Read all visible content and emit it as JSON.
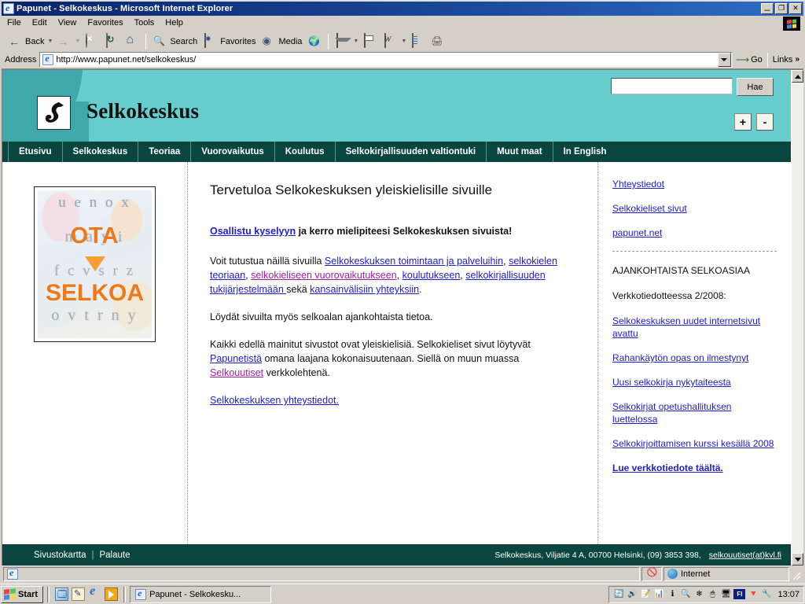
{
  "window": {
    "title": "Papunet - Selkokeskus  - Microsoft Internet Explorer",
    "minimize_label": "_",
    "maximize_label": "❐",
    "close_label": "✕"
  },
  "menubar": {
    "items": [
      "File",
      "Edit",
      "View",
      "Favorites",
      "Tools",
      "Help"
    ]
  },
  "toolbar": {
    "back_label": "Back",
    "search_label": "Search",
    "favorites_label": "Favorites",
    "media_label": "Media"
  },
  "addressbar": {
    "label": "Address",
    "url": "http://www.papunet.net/selkokeskus/",
    "go_label": "Go",
    "links_label": "Links",
    "chevron": "»"
  },
  "site": {
    "title": "Selkokeskus",
    "search": {
      "value": "",
      "button_label": "Hae"
    },
    "zoom": {
      "increase_label": "+",
      "decrease_label": "-"
    },
    "nav": [
      "Etusivu",
      "Selkokeskus",
      "Teoriaa",
      "Vuorovaikutus",
      "Koulutus",
      "Selkokirjallisuuden valtiontuki",
      "Muut maat",
      "In English"
    ],
    "poster": {
      "row1": "u e n o x",
      "row2": "m a  y i",
      "row3": "f c v s r z",
      "row4": "o v t r n y",
      "word1": "OTA",
      "word2": "SELKOA"
    },
    "main": {
      "heading": "Tervetuloa Selkokeskuksen yleiskielisille sivuille",
      "lead_link": "Osallistu kyselyyn",
      "lead_rest": " ja kerro mielipiteesi Selkokeskuksen sivuista!",
      "p2_pre": "Voit tutustua näillä sivuilla ",
      "p2_l1": "Selkokeskuksen toimintaan ja palveluihin",
      "p2_s1": ", ",
      "p2_l2": "selkokielen teoriaan",
      "p2_s2": ", ",
      "p2_l3": "selkokieliseen vuorovaikutukseen",
      "p2_s3": ", ",
      "p2_l4": "koulutukseen",
      "p2_s4": ", ",
      "p2_l5": "selkokirjallisuuden tukijärjestelmään ",
      "p2_s5": "sekä ",
      "p2_l6": "kansainvälisiin yhteyksiin",
      "p2_end": ".",
      "p3": "Löydät sivuilta myös selkoalan ajankohtaista tietoa.",
      "p4_pre": "Kaikki edellä mainitut sivustot ovat yleiskielisiä. Selkokieliset sivut löytyvät ",
      "p4_l1": "Papunetistä",
      "p4_mid": " omana laajana kokonaisuutenaan. Siellä on muun muassa ",
      "p4_l2": "Selkouutiset",
      "p4_end": " verkkolehtenä.",
      "p5_link": "Selkokeskuksen yhteystiedot."
    },
    "sidebar": {
      "links": [
        "Yhteystiedot",
        "Selkokieliset sivut",
        "papunet.net"
      ],
      "news_heading": "AJANKOHTAISTA SELKOASIAA",
      "news_subheading": "Verkkotiedotteessa 2/2008:",
      "news": [
        {
          "text": "Selkokeskuksen uudet internetsivut avattu",
          "bold": false
        },
        {
          "text": "Rahankäytön opas on ilmestynyt",
          "bold": false
        },
        {
          "text": "Uusi selkokirja nykytaiteesta",
          "bold": false
        },
        {
          "text": "Selkokirjat opetushallituksen luettelossa",
          "bold": false
        },
        {
          "text": "Selkokirjoittamisen kurssi kesällä 2008",
          "bold": false
        },
        {
          "text": "Lue verkkotiedote täältä.",
          "bold": true
        }
      ]
    },
    "footer": {
      "sitemap": "Sivustokartta",
      "divider": "|",
      "feedback": "Palaute",
      "address": "Selkokeskus, Viljatie 4 A, 00700 Helsinki, (09) 3853 398,",
      "email": "selkouutiset(at)kvl.fi"
    }
  },
  "statusbar": {
    "message": "",
    "zone": "Internet"
  },
  "taskbar": {
    "start_label": "Start",
    "task_label": "Papunet - Selkokesku...",
    "lang": "FI",
    "time": "13:07"
  },
  "colors": {
    "header_teal": "#66cccc",
    "header_teal_dark": "#3fa8ab",
    "nav_dark": "#0a4540",
    "link_blue": "#2020cc",
    "link_visited": "#a020a0",
    "accent_orange": "#f07818",
    "chrome": "#d4d0c8",
    "titlebar_blue": "#0a246a"
  }
}
